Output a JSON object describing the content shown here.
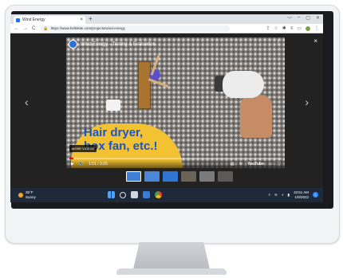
{
  "browser": {
    "tab_title": "Wind Energy",
    "tab_close": "×",
    "new_tab": "+",
    "window_controls": [
      "﹀",
      "–",
      "▢",
      "✕"
    ],
    "nav": [
      "←",
      "→",
      "C"
    ],
    "url": "https://www.hellokite.com/projects/wind-energy"
  },
  "lightbox": {
    "close": "×",
    "prev": "‹",
    "next": "›",
    "video": {
      "channel_title": "Wind Energy - Testing & Evaluation",
      "menu": "⋮",
      "caption_line1": "Hair dryer,",
      "caption_line2": "box fan, etc.!",
      "more_videos_label": "MORE VIDEOS",
      "time": "1:01 / 3:25",
      "progress": 0.02,
      "youtube_label": "YouTube"
    },
    "thumbnails": [
      "#3f7fd8",
      "#4b86d9",
      "#2e76d2",
      "#6a6456",
      "#7a7a7a",
      "#5c5a58"
    ]
  },
  "taskbar": {
    "weather_temp": "35°F",
    "weather_desc": "Sunny",
    "time": "10:51 AM",
    "date": "1/8/2022",
    "notification_count": "1"
  },
  "colors": {
    "accent": "#1a73e8",
    "caption": "#1b55c7",
    "caption_bg": "#f3c233",
    "taskbar": "#1e2a3a"
  }
}
